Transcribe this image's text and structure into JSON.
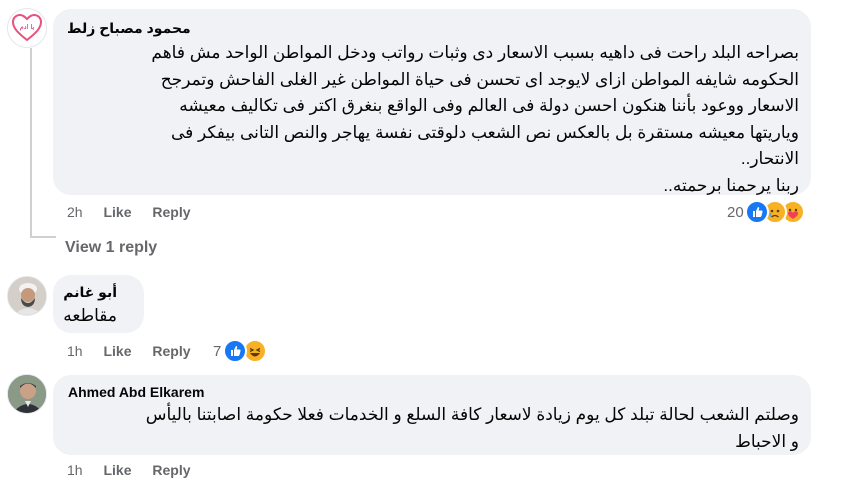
{
  "comments": [
    {
      "author": "محمود مصباح زلط",
      "avatar_label": "يا ادم",
      "lines": [
        "بصراحه البلد راحت فى داهيه بسبب الاسعار دى وثبات رواتب ودخل المواطن الواحد مش فاهم",
        "الحكومه شايفه المواطن ازاى لايوجد اى تحسن فى حياة المواطن غير الغلى الفاحش وتمرجح",
        "الاسعار ووعود بأننا هنكون احسن دولة فى العالم وفى الواقع بنغرق اكتر فى تكاليف معيشه",
        "وياريتها معيشه مستقرة بل بالعكس نص الشعب دلوقتى نفسة يهاجر والنص التانى بيفكر فى",
        "الانتحار..",
        "ربنا يرحمنا برحمته.."
      ],
      "time": "2h",
      "like_label": "Like",
      "reply_label": "Reply",
      "reaction_count": "20",
      "reactions": [
        "like-icon",
        "sad-icon",
        "care-icon"
      ]
    },
    {
      "author": "أبو غانم",
      "lines": [
        "مقاطعه"
      ],
      "time": "1h",
      "like_label": "Like",
      "reply_label": "Reply",
      "reaction_count": "7",
      "reactions": [
        "like-icon",
        "haha-icon"
      ]
    },
    {
      "author": "Ahmed Abd Elkarem",
      "lines": [
        "وصلتم الشعب لحالة تبلد كل يوم زيادة لاسعار كافة السلع و الخدمات فعلا حكومة اصابتنا باليأس",
        "و الاحباط"
      ],
      "time": "1h",
      "like_label": "Like",
      "reply_label": "Reply"
    }
  ],
  "view_replies_label": "View 1 reply",
  "colors": {
    "bubble": "#f0f2f5",
    "secondary_text": "#65676b",
    "like_blue": "#1877f2"
  }
}
